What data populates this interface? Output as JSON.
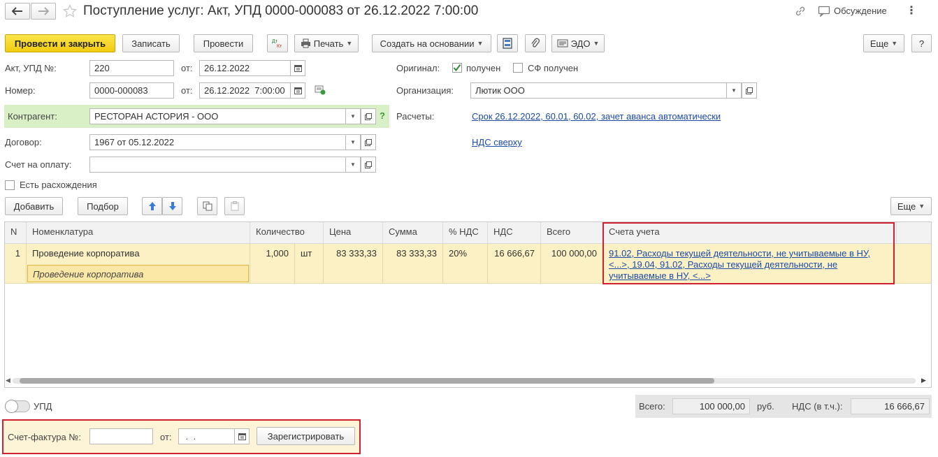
{
  "header": {
    "title": "Поступление услуг: Акт, УПД 0000-000083 от 26.12.2022 7:00:00",
    "discussion": "Обсуждение"
  },
  "toolbar": {
    "post_close": "Провести и закрыть",
    "save": "Записать",
    "post": "Провести",
    "dtkt": "Дт Кт",
    "print": "Печать",
    "create_basis": "Создать на основании",
    "edo": "ЭДО",
    "more": "Еще",
    "help": "?"
  },
  "form": {
    "act_label": "Акт, УПД №:",
    "act_value": "220",
    "from_label": "от:",
    "act_date": "26.12.2022",
    "number_label": "Номер:",
    "number_value": "0000-000083",
    "number_date": "26.12.2022  7:00:00",
    "contractor_label": "Контрагент:",
    "contractor_value": "РЕСТОРАН АСТОРИЯ - ООО",
    "contract_label": "Договор:",
    "contract_value": "1967 от 05.12.2022",
    "invoice_label": "Счет на оплату:",
    "invoice_value": "",
    "discrepancy_label": "Есть расхождения",
    "original_label": "Оригинал:",
    "received_label": "получен",
    "sf_received_label": "СФ получен",
    "org_label": "Организация:",
    "org_value": "Лютик ООО",
    "settlements_label": "Расчеты:",
    "settlements_link": "Срок 26.12.2022, 60.01, 60.02, зачет аванса автоматически",
    "vat_link": "НДС сверху"
  },
  "table_toolbar": {
    "add": "Добавить",
    "select": "Подбор",
    "more": "Еще"
  },
  "table": {
    "columns": [
      "N",
      "Номенклатура",
      "Количество",
      "Цена",
      "Сумма",
      "% НДС",
      "НДС",
      "Всего",
      "Счета учета"
    ],
    "rows": [
      {
        "n": "1",
        "item": "Проведение корпоратива",
        "item_sub": "Проведение корпоратива",
        "qty": "1,000",
        "unit": "шт",
        "price": "83 333,33",
        "sum": "83 333,33",
        "vat_rate": "20%",
        "vat": "16 666,67",
        "total": "100 000,00",
        "accounts_line1": "91.02, Расходы текущей деятельности, не учитываемые в НУ,",
        "accounts_line2": "<...>, 19.04, 91.02, Расходы текущей деятельности, не",
        "accounts_line3": "учитываемые в НУ, <...>"
      }
    ]
  },
  "footer": {
    "upd_label": "УПД",
    "total_label": "Всего:",
    "total_value": "100 000,00",
    "currency": "руб.",
    "vat_incl_label": "НДС (в т.ч.):",
    "vat_incl_value": "16 666,67",
    "sf_label": "Счет-фактура №:",
    "sf_value": "",
    "sf_from_label": "от:",
    "sf_date": " .  .",
    "register": "Зарегистрировать"
  },
  "colors": {
    "accent_yellow": "#f5d21b",
    "highlight_red": "#d1202f",
    "link_blue": "#1b4aa8",
    "row_selected": "#fbf1c4",
    "contractor_bg": "#d9efc6"
  }
}
